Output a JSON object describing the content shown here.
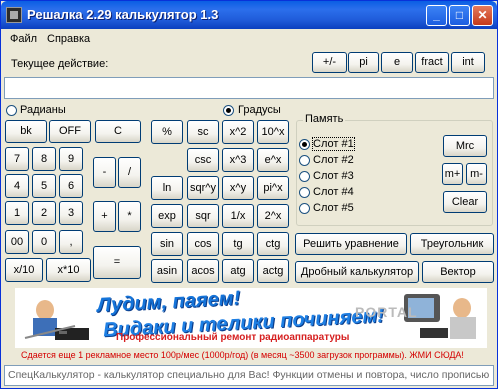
{
  "window": {
    "title": "Решалка 2.29 калькулятор 1.3",
    "controls": [
      "minimize",
      "maximize",
      "close"
    ]
  },
  "menu": {
    "items": [
      "Файл",
      "Справка"
    ]
  },
  "current_action": {
    "label": "Текущее действие:",
    "value": ""
  },
  "top_buttons": [
    "+/-",
    "pi",
    "e",
    "fract",
    "int"
  ],
  "angle_mode": {
    "radians_label": "Радианы",
    "degrees_label": "Градусы",
    "selected": "Градусы"
  },
  "keypad": {
    "bk": "bk",
    "off": "OFF",
    "clear": "C",
    "digits": [
      "7",
      "8",
      "9",
      "4",
      "5",
      "6",
      "1",
      "2",
      "3",
      "00",
      "0",
      ","
    ],
    "minus": "-",
    "divide": "/",
    "plus": "+",
    "multiply": "*",
    "equals": "=",
    "x10": "x/10",
    "xtimes10": "x*10"
  },
  "functions": [
    [
      "%",
      "sc",
      "x^2",
      "10^x"
    ],
    [
      "csc",
      "x^3",
      "e^x"
    ],
    [
      "ln",
      "sqr^y",
      "x^y",
      "pi^x"
    ],
    [
      "exp",
      "sqr",
      "1/x",
      "2^x"
    ],
    [
      "sin",
      "cos",
      "tg",
      "ctg"
    ],
    [
      "asin",
      "acos",
      "atg",
      "actg"
    ]
  ],
  "memory": {
    "title": "Память",
    "slots": [
      "Слот #1",
      "Слот #2",
      "Слот #3",
      "Слот #4",
      "Слот #5"
    ],
    "selected": 0,
    "mrc": "Mrc",
    "mplus": "m+",
    "mminus": "m-",
    "clear": "Clear"
  },
  "tools": {
    "solve_equation": "Решить уравнение",
    "triangle": "Треугольник",
    "fraction_calc": "Дробный калькулятор",
    "vector": "Вектор"
  },
  "banner": {
    "line1": "Лудим, паяем!",
    "line2": "Видаки и телики починяем!",
    "line3": "Профессиональный ремонт радиоаппаратуры",
    "watermark": "PORTAL"
  },
  "ad_line": "Сдается еще 1 рекламное место 100р/мес (1000р/год) (в месяц ~3500 загрузок программы). ЖМИ СЮДА!",
  "status_bar": "СпецКалькулятор - калькулятор специально для Вас! Функции отмены и повтора, число прописью"
}
